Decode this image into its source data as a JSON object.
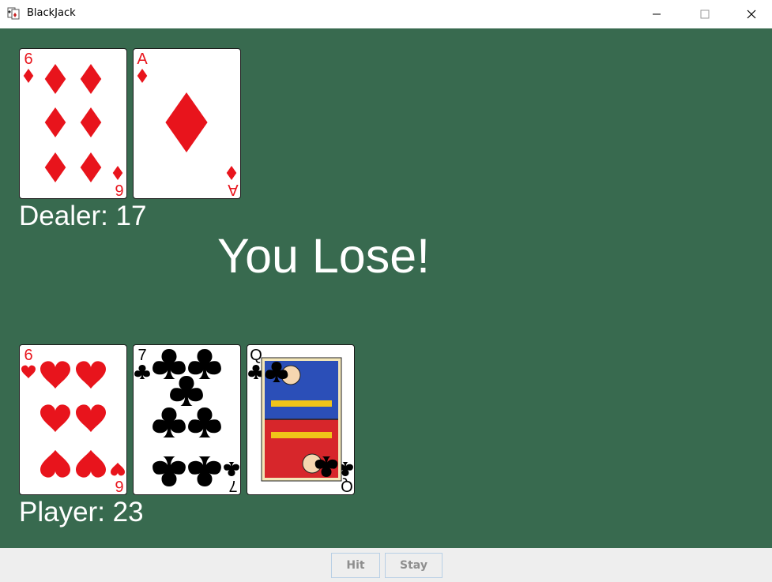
{
  "window": {
    "title": "BlackJack",
    "minimize_icon": "minimize-icon",
    "maximize_icon": "maximize-icon",
    "close_icon": "close-icon"
  },
  "colors": {
    "felt": "#386a4f",
    "red_suit": "#e8141c",
    "black_suit": "#000000",
    "button_bar": "#eeeeee"
  },
  "dealer": {
    "score_label": "Dealer: 17",
    "cards": [
      {
        "rank": "6",
        "suit": "diamonds",
        "color": "red"
      },
      {
        "rank": "A",
        "suit": "diamonds",
        "color": "red"
      }
    ]
  },
  "result_text": "You Lose!",
  "player": {
    "score_label": "Player: 23",
    "cards": [
      {
        "rank": "6",
        "suit": "hearts",
        "color": "red"
      },
      {
        "rank": "7",
        "suit": "clubs",
        "color": "black"
      },
      {
        "rank": "Q",
        "suit": "clubs",
        "color": "black"
      }
    ]
  },
  "buttons": {
    "hit_label": "Hit",
    "stay_label": "Stay",
    "enabled": false
  }
}
